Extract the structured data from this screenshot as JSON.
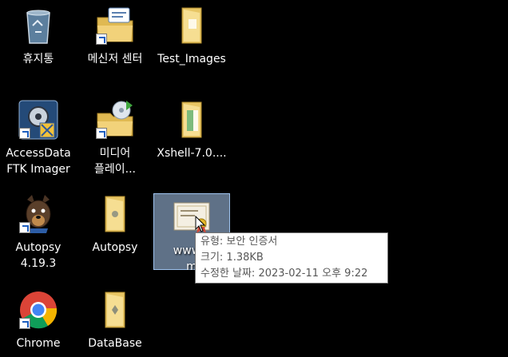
{
  "desktop": {
    "icons": [
      {
        "label": "휴지통",
        "icon": "recycle-bin-icon"
      },
      {
        "label": "메신저 센터",
        "icon": "messenger-folder-icon"
      },
      {
        "label": "Test_Images",
        "icon": "folder-icon"
      },
      {
        "label": "AccessData FTK Imager",
        "line1": "AccessData",
        "line2": "FTK Imager",
        "icon": "ftk-imager-icon"
      },
      {
        "label": "미디어 플레이...",
        "line1": "미디어",
        "line2": "플레이...",
        "icon": "media-player-folder-icon"
      },
      {
        "label": "Xshell-7.0....",
        "icon": "folder-icon"
      },
      {
        "label": "Autopsy 4.19.3",
        "line1": "Autopsy",
        "line2": "4.19.3",
        "icon": "autopsy-icon"
      },
      {
        "label": "Autopsy",
        "icon": "folder-icon"
      },
      {
        "label": "www.d... m",
        "line1": "www.d",
        "line2": "m",
        "icon": "certificate-icon"
      },
      {
        "label": "Chrome",
        "icon": "chrome-icon"
      },
      {
        "label": "DataBase",
        "icon": "folder-icon"
      }
    ]
  },
  "tooltip": {
    "type_line": "유형: 보안 인증서",
    "size_line": "크기: 1.38KB",
    "modified_line": "수정한 날짜: 2023-02-11 오후 9:22"
  }
}
